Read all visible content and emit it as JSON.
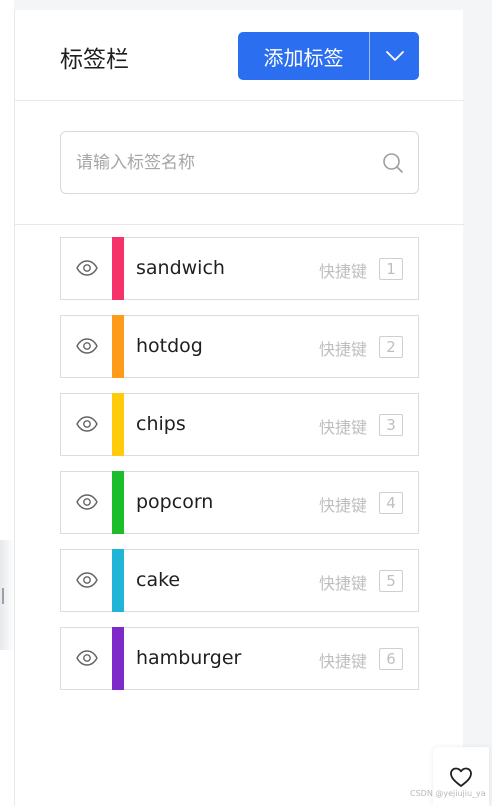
{
  "header": {
    "title": "标签栏",
    "add_label": "添加标签"
  },
  "search": {
    "placeholder": "请输入标签名称"
  },
  "labels": [
    {
      "name": "sandwich",
      "color": "#f5336a",
      "shortcut_text": "快捷键",
      "shortcut_key": "1"
    },
    {
      "name": "hotdog",
      "color": "#ff9b1a",
      "shortcut_text": "快捷键",
      "shortcut_key": "2"
    },
    {
      "name": "chips",
      "color": "#ffcb0a",
      "shortcut_text": "快捷键",
      "shortcut_key": "3"
    },
    {
      "name": "popcorn",
      "color": "#1cbd2a",
      "shortcut_text": "快捷键",
      "shortcut_key": "4"
    },
    {
      "name": "cake",
      "color": "#20b4d6",
      "shortcut_text": "快捷键",
      "shortcut_key": "5"
    },
    {
      "name": "hamburger",
      "color": "#7e2ac9",
      "shortcut_text": "快捷键",
      "shortcut_key": "6"
    }
  ],
  "icons": {
    "dropdown": "chevron-down-icon",
    "search": "search-icon",
    "visibility": "eye-icon",
    "favorite": "heart-icon"
  },
  "colors": {
    "primary": "#2b6ff0"
  },
  "watermark": "CSDN @yejiujiu_ya"
}
